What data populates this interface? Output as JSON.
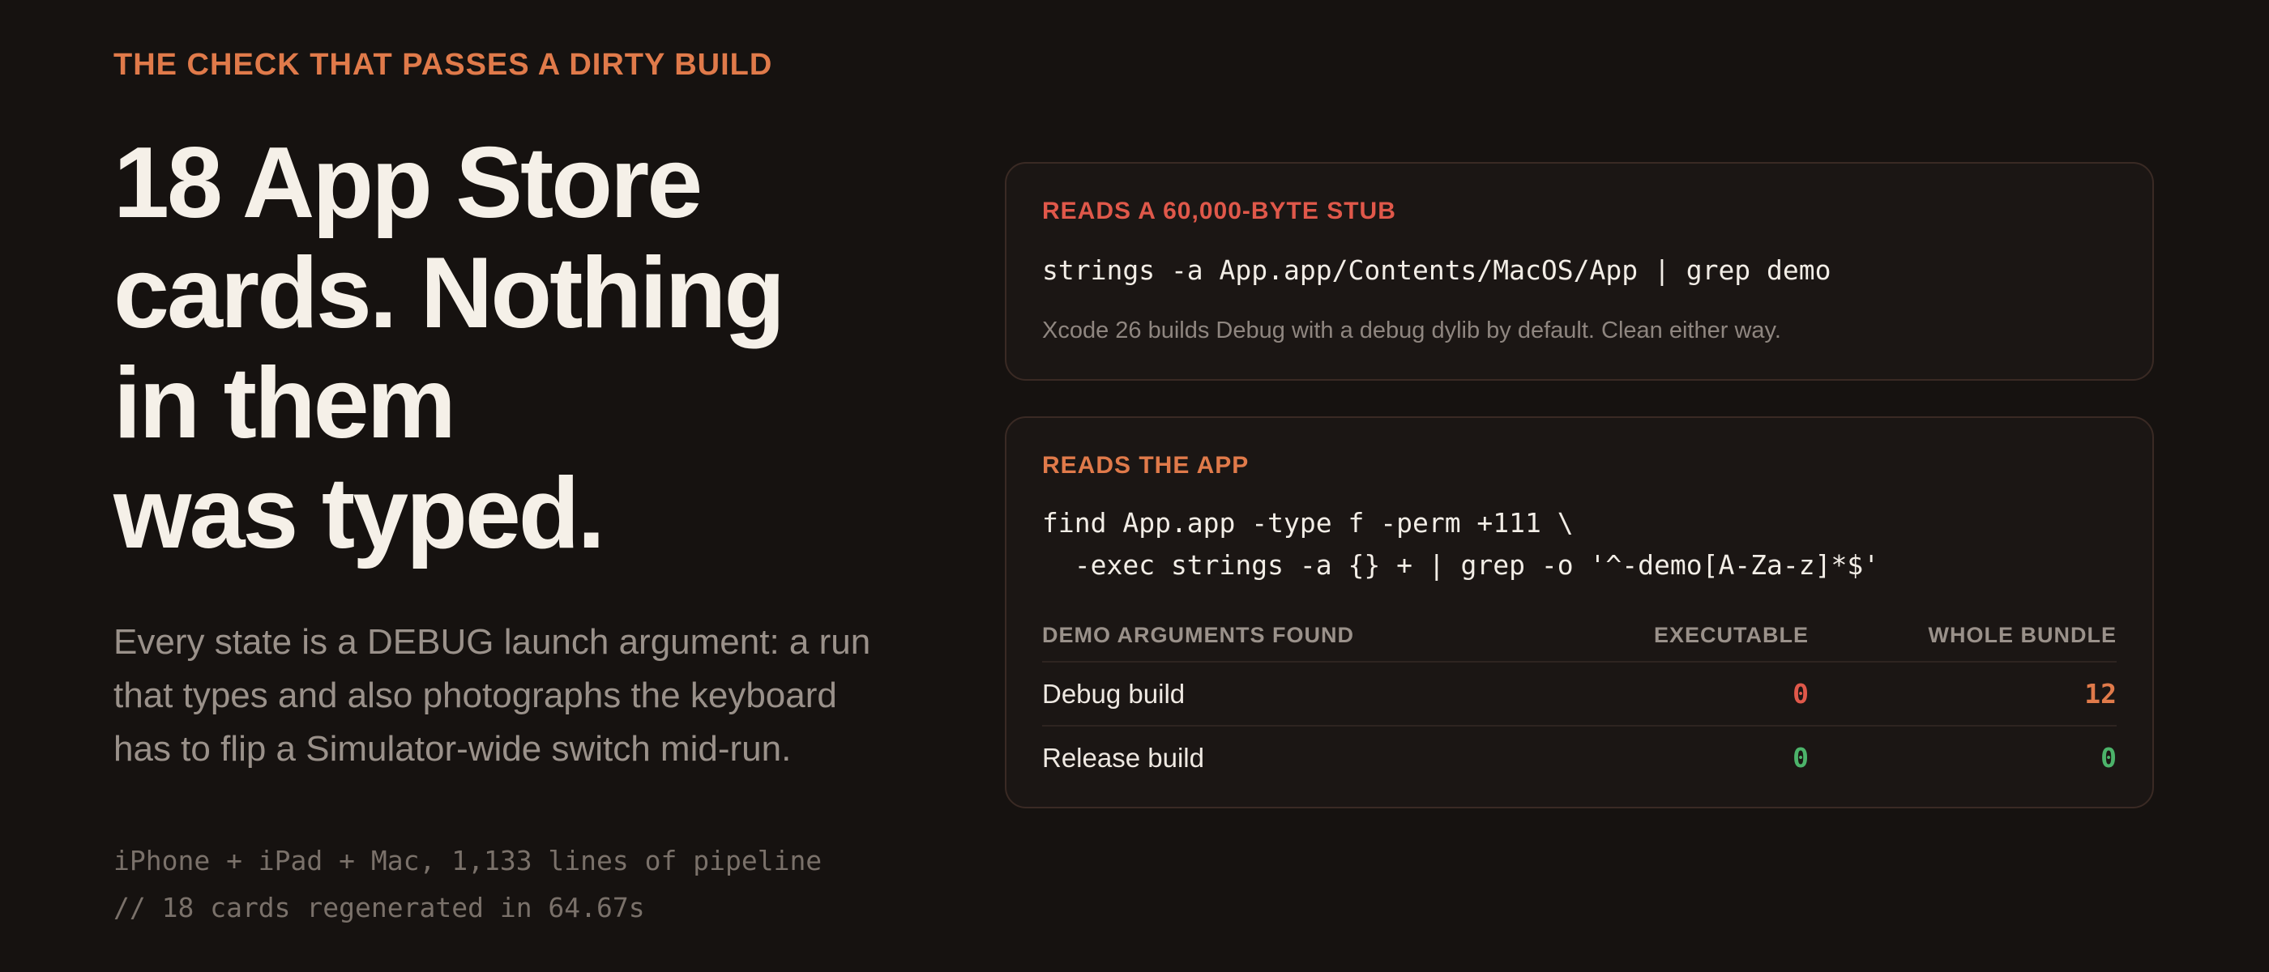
{
  "left": {
    "eyebrow": "THE CHECK THAT PASSES A DIRTY BUILD",
    "headline_lines": [
      "18 App Store",
      "cards. Nothing",
      "in them",
      "was typed."
    ],
    "description_lines": [
      "Every state is a DEBUG launch argument: a run",
      "that types and also photographs the keyboard",
      "has to flip a Simulator-wide switch mid-run."
    ],
    "meta_lines": [
      "iPhone + iPad + Mac, 1,133 lines of pipeline",
      "// 18 cards regenerated in 64.67s"
    ]
  },
  "card_stub": {
    "label": "READS A 60,000-BYTE STUB",
    "command": "strings -a App.app/Contents/MacOS/App | grep demo",
    "note": "Xcode 26 builds Debug with a debug dylib by default. Clean either way."
  },
  "card_app": {
    "label": "READS THE APP",
    "command_lines": [
      "find App.app -type f -perm +111 \\",
      "  -exec strings -a {} + | grep -o '^-demo[A-Za-z]*$'"
    ],
    "table": {
      "headers": [
        "DEMO ARGUMENTS FOUND",
        "EXECUTABLE",
        "WHOLE BUNDLE"
      ],
      "rows": [
        {
          "label": "Debug build",
          "executable": "0",
          "bundle": "12"
        },
        {
          "label": "Release build",
          "executable": "0",
          "bundle": "0"
        }
      ]
    }
  },
  "colors": {
    "accent_orange": "#e07a4a",
    "accent_red": "#e0584a",
    "ok_green": "#4cb36a",
    "background": "#161210"
  }
}
